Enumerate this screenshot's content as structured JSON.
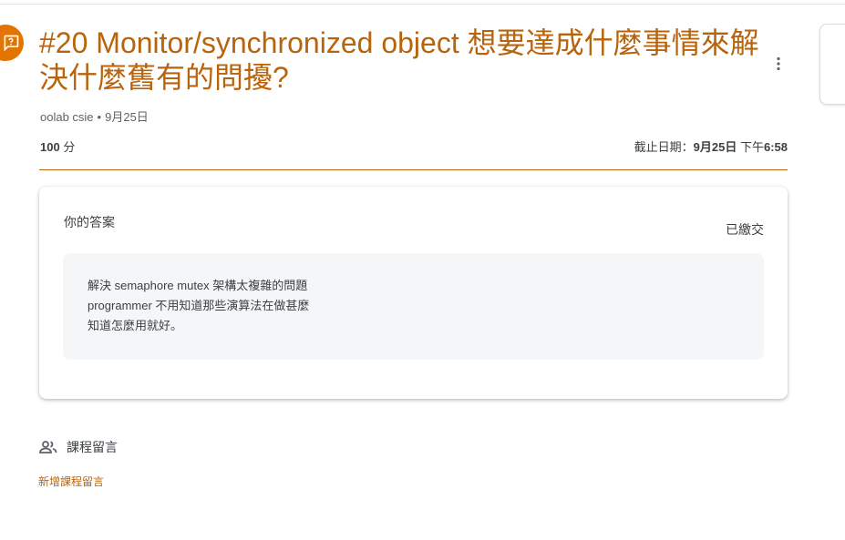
{
  "assignment": {
    "title": "#20 Monitor/synchronized object 想要達成什麼事情來解決什麼舊有的問擾?",
    "author": "oolab csie",
    "separator": "•",
    "posted_date": "9月25日",
    "points_value": "100",
    "points_unit": "分",
    "due_label": "截止日期：",
    "due_date": "9月25日",
    "due_period": "下午",
    "due_time": "6:58",
    "accent_color": "#b8640c",
    "icon_color": "#e37400"
  },
  "answer": {
    "heading": "你的答案",
    "status": "已繳交",
    "lines": [
      "解決 semaphore mutex 架構太複雜的問題",
      "programmer 不用知道那些演算法在做甚麼",
      "知道怎麼用就好。"
    ]
  },
  "comments": {
    "icon": "people-icon",
    "heading": "課程留言",
    "add_link": "新增課程留言"
  },
  "icons": {
    "assignment": "assignment-question-icon",
    "more": "more-vert-icon"
  }
}
